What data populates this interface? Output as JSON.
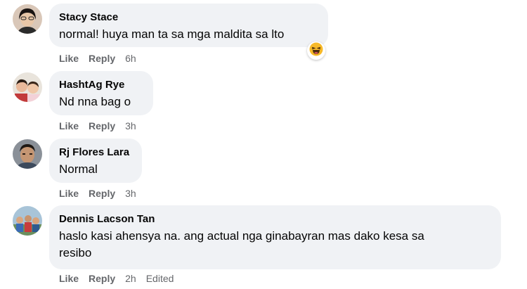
{
  "comments": [
    {
      "author": "Stacy Stace",
      "text": "normal! huya man ta sa mga maldita sa lto",
      "like": "Like",
      "reply": "Reply",
      "time": "6h",
      "reaction_icon": "laughing-emoji-icon"
    },
    {
      "author": "HashtAg Rye",
      "text": "Nd nna bag o",
      "like": "Like",
      "reply": "Reply",
      "time": "3h"
    },
    {
      "author": "Rj Flores Lara",
      "text": "Normal",
      "like": "Like",
      "reply": "Reply",
      "time": "3h"
    },
    {
      "author": "Dennis Lacson Tan",
      "text_line1": "haslo kasi ahensya na. ang actual nga ginabayran mas dako kesa sa",
      "text_line2": "resibo",
      "like": "Like",
      "reply": "Reply",
      "time": "2h",
      "edited": "Edited"
    }
  ],
  "colors": {
    "bubble": "#f0f2f5",
    "meta": "#65676b",
    "text": "#050505",
    "emoji": "#f7b928"
  }
}
